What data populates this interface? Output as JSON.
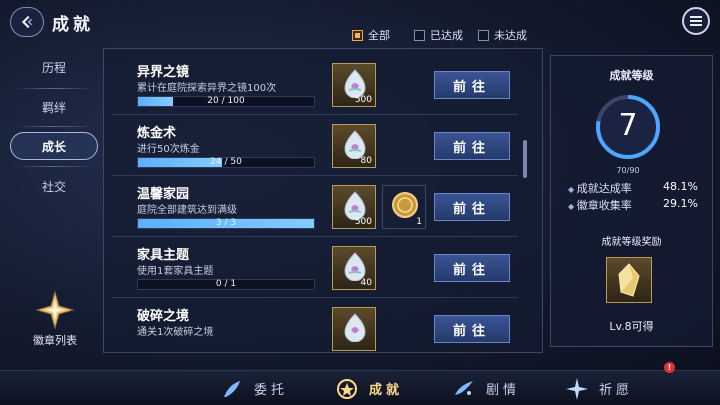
{
  "header": {
    "title": "成就"
  },
  "filters": [
    {
      "label": "全部",
      "checked": true
    },
    {
      "label": "已达成",
      "checked": false
    },
    {
      "label": "未达成",
      "checked": false
    }
  ],
  "nav": [
    {
      "label": "历程",
      "active": false
    },
    {
      "label": "羁绊",
      "active": false
    },
    {
      "label": "成长",
      "active": true
    },
    {
      "label": "社交",
      "active": false
    }
  ],
  "badge_list": {
    "label": "徽章列表"
  },
  "achievements": [
    {
      "name": "异界之镜",
      "desc": "累计在庭院探索异界之镜100次",
      "progress": "20 / 100",
      "ratio": 0.2,
      "rewards": [
        {
          "type": "crystal-icon",
          "count": "500"
        }
      ],
      "button": "前往"
    },
    {
      "name": "炼金术",
      "desc": "进行50次炼金",
      "progress": "24 / 50",
      "ratio": 0.48,
      "rewards": [
        {
          "type": "crystal-icon",
          "count": "80"
        }
      ],
      "button": "前往"
    },
    {
      "name": "温馨家园",
      "desc": "庭院全部建筑达到满级",
      "progress": "3 / 3",
      "ratio": 1.0,
      "rewards": [
        {
          "type": "crystal-icon",
          "count": "500"
        },
        {
          "type": "coin-icon",
          "count": "1"
        }
      ],
      "button": "前往"
    },
    {
      "name": "家具主题",
      "desc": "使用1套家具主题",
      "progress": "0 / 1",
      "ratio": 0.0,
      "rewards": [
        {
          "type": "crystal-icon",
          "count": "40"
        }
      ],
      "button": "前往"
    },
    {
      "name": "破碎之境",
      "desc": "通关1次破碎之境",
      "progress": "",
      "ratio": 0.0,
      "rewards": [
        {
          "type": "crystal-icon",
          "count": ""
        }
      ],
      "button": "前往"
    }
  ],
  "level_panel": {
    "title": "成就等级",
    "level": "7",
    "exp": "70/90",
    "exp_ratio": 0.78,
    "stats": [
      {
        "label": "成就达成率",
        "value": "48.1%"
      },
      {
        "label": "徽章收集率",
        "value": "29.1%"
      }
    ],
    "reward_title": "成就等级奖励",
    "reward_hint": "Lv.8可得"
  },
  "tabs": [
    {
      "label": "委托",
      "icon": "feather-icon",
      "active": false
    },
    {
      "label": "成就",
      "icon": "medal-icon",
      "active": true
    },
    {
      "label": "剧情",
      "icon": "wave-icon",
      "active": false
    },
    {
      "label": "祈愿",
      "icon": "star-burst-icon",
      "active": false
    }
  ],
  "colors": {
    "accent": "#f4b655",
    "progress": "#5ab0ff",
    "button": "#2f4a84"
  }
}
